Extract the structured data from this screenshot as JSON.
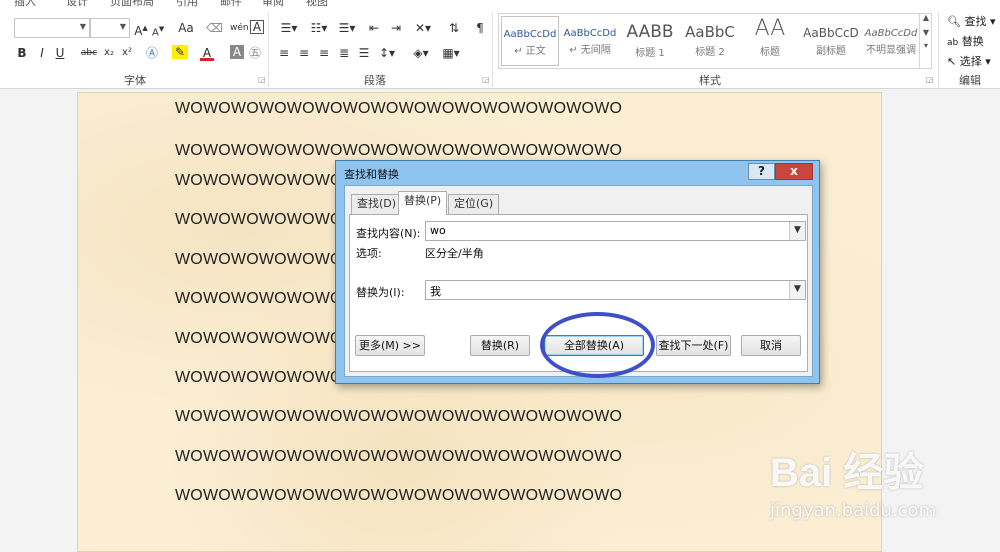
{
  "ribbon": {
    "tabs": [
      "插入",
      "设计",
      "页面布局",
      "引用",
      "邮件",
      "审阅",
      "视图"
    ],
    "groups": {
      "font": "字体",
      "paragraph": "段落",
      "styles": "样式",
      "editing": "编辑"
    },
    "font_buttons": [
      "B",
      "I",
      "U",
      "abc",
      "x₂",
      "x²",
      "A",
      "A"
    ],
    "styles": [
      {
        "preview": "AaBbCcDd",
        "name": "↵ 正文"
      },
      {
        "preview": "AaBbCcDd",
        "name": "↵ 无间隔"
      },
      {
        "preview": "AABB",
        "name": "标题 1"
      },
      {
        "preview": "AaBbC",
        "name": "标题 2"
      },
      {
        "preview": "AA",
        "name": "标题"
      },
      {
        "preview": "AaBbCcD",
        "name": "副标题"
      },
      {
        "preview": "AaBbCcDd",
        "name": "不明显强调"
      }
    ],
    "editing_items": [
      "查找",
      "替换",
      "选择"
    ]
  },
  "document": {
    "lines": [
      "WOWOWOWOWOWOWOWOWOWOWOWOWOWOWOWO",
      "WOWOWOWOWOWOWOWOWOWOWOWOWOWOWOWO",
      "WOWOWOWOWOWO",
      "WOWOWOWOWOWO",
      "WOWOWOWOWOWO",
      "WOWOWOWOWOWO",
      "WOWOWOWOWOWO",
      "WOWOWOWOWOWO",
      "WOWOWOWOWOWOWOWOWOWOWOWOWOWOWOWO",
      "WOWOWOWOWOWOWOWOWOWOWOWOWOWOWOWO",
      "WOWOWOWOWOWOWOWOWOWOWOWOWOWOWOWO"
    ]
  },
  "dialog": {
    "title": "查找和替换",
    "help": "?",
    "close": "x",
    "tabs": [
      {
        "label": "查找(D)",
        "active": false
      },
      {
        "label": "替换(P)",
        "active": true
      },
      {
        "label": "定位(G)",
        "active": false
      }
    ],
    "find_label": "查找内容(N):",
    "find_value": "wo",
    "options_label": "选项:",
    "options_value": "区分全/半角",
    "replace_label": "替换为(I):",
    "replace_value": "我",
    "buttons": {
      "more": "更多(M) >>",
      "replace": "替换(R)",
      "replace_all": "全部替换(A)",
      "find_next": "查找下一处(F)",
      "cancel": "取消"
    },
    "highlight_color": "#3e50c8"
  },
  "watermark": {
    "logo": "Bai 经验",
    "url": "jingyan.baidu.com"
  },
  "colors": {
    "page": "#fbeed3",
    "dialog_frame": "#8fc4ee",
    "close_button": "#c9463d"
  }
}
